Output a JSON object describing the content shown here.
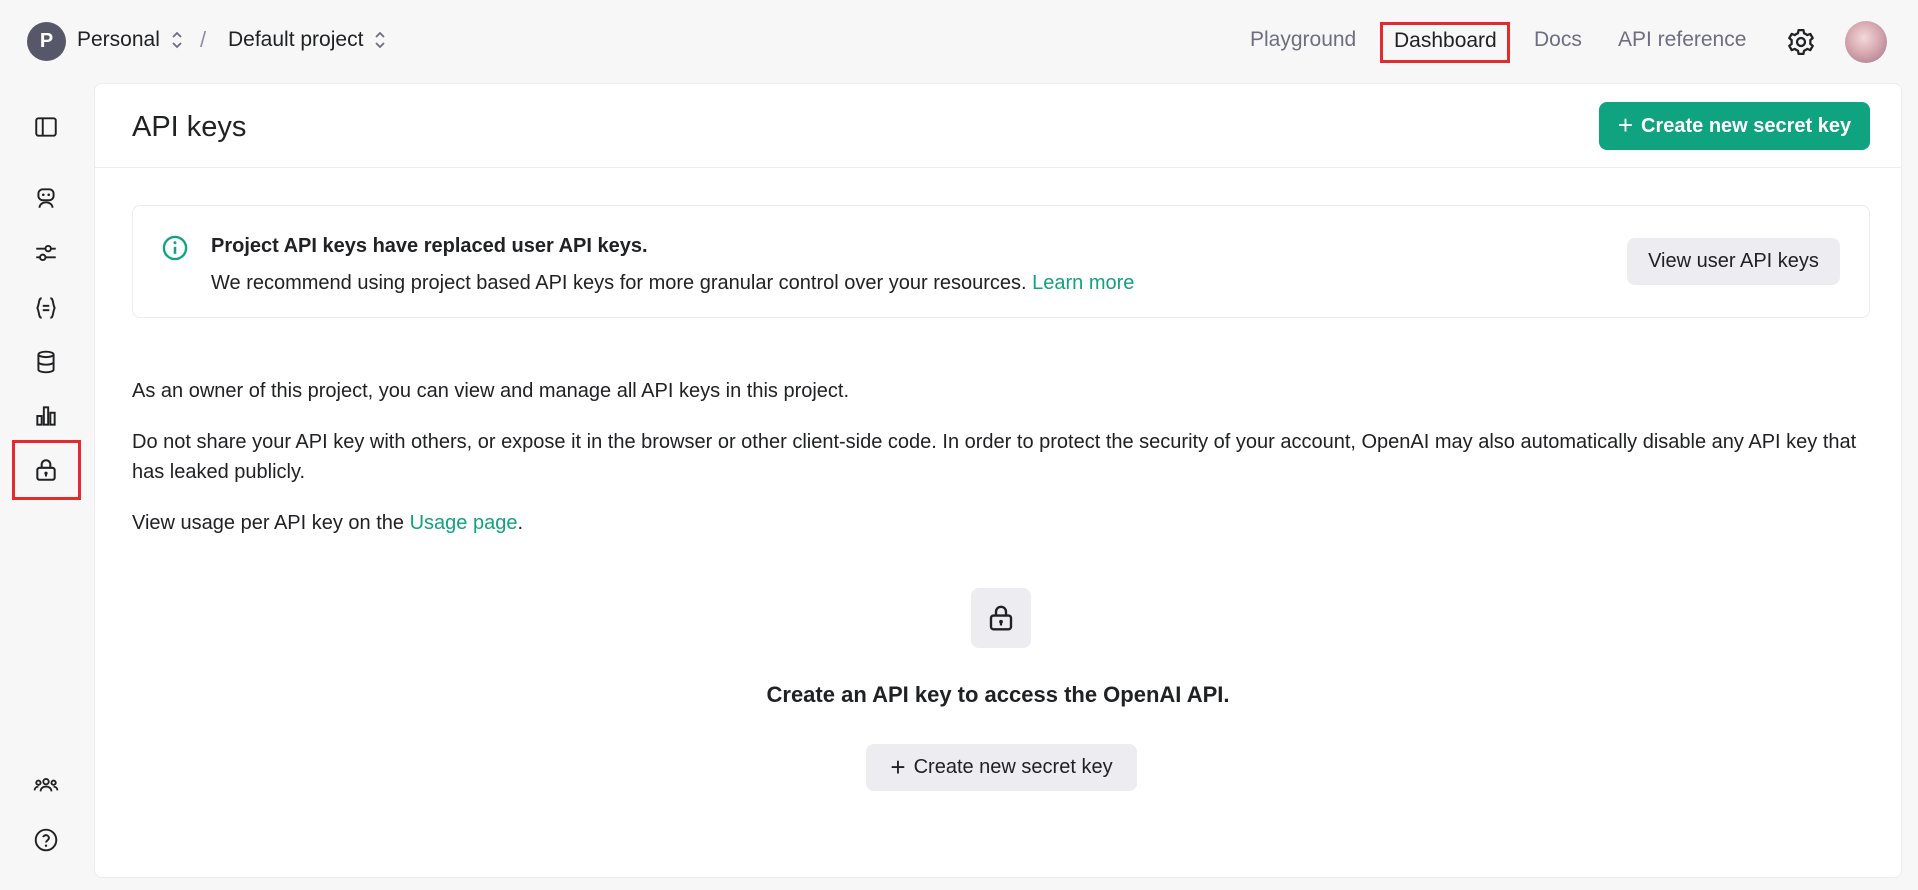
{
  "header": {
    "org_initial": "P",
    "org_name": "Personal",
    "separator": "/",
    "project_name": "Default project",
    "nav": {
      "playground": "Playground",
      "dashboard": "Dashboard",
      "docs": "Docs",
      "api_reference": "API reference"
    }
  },
  "sidebar": {
    "items": [
      {
        "icon": "sidebar-toggle-icon"
      },
      {
        "icon": "assistants-robot-icon"
      },
      {
        "icon": "fine-tuning-sliders-icon"
      },
      {
        "icon": "batches-braces-icon"
      },
      {
        "icon": "storage-database-icon"
      },
      {
        "icon": "usage-bar-chart-icon"
      },
      {
        "icon": "api-keys-lock-icon",
        "selected": true
      },
      {
        "icon": "team-people-icon"
      },
      {
        "icon": "help-question-icon"
      }
    ]
  },
  "main": {
    "title": "API keys",
    "create_button": "Create new secret key",
    "notice": {
      "title": "Project API keys have replaced user API keys.",
      "body": "We recommend using project based API keys for more granular control over your resources.",
      "link": "Learn more",
      "button": "View user API keys"
    },
    "para1": "As an owner of this project, you can view and manage all API keys in this project.",
    "para2": "Do not share your API key with others, or expose it in the browser or other client-side code. In order to protect the security of your account, OpenAI may also automatically disable any API key that has leaked publicly.",
    "para3_prefix": "View usage per API key on the",
    "para3_link": "Usage page",
    "para3_suffix": ".",
    "empty_state": {
      "title": "Create an API key to access the OpenAI API.",
      "button": "Create new secret key"
    }
  },
  "colors": {
    "accent": "#10a37f",
    "highlight": "#e32b2b"
  }
}
